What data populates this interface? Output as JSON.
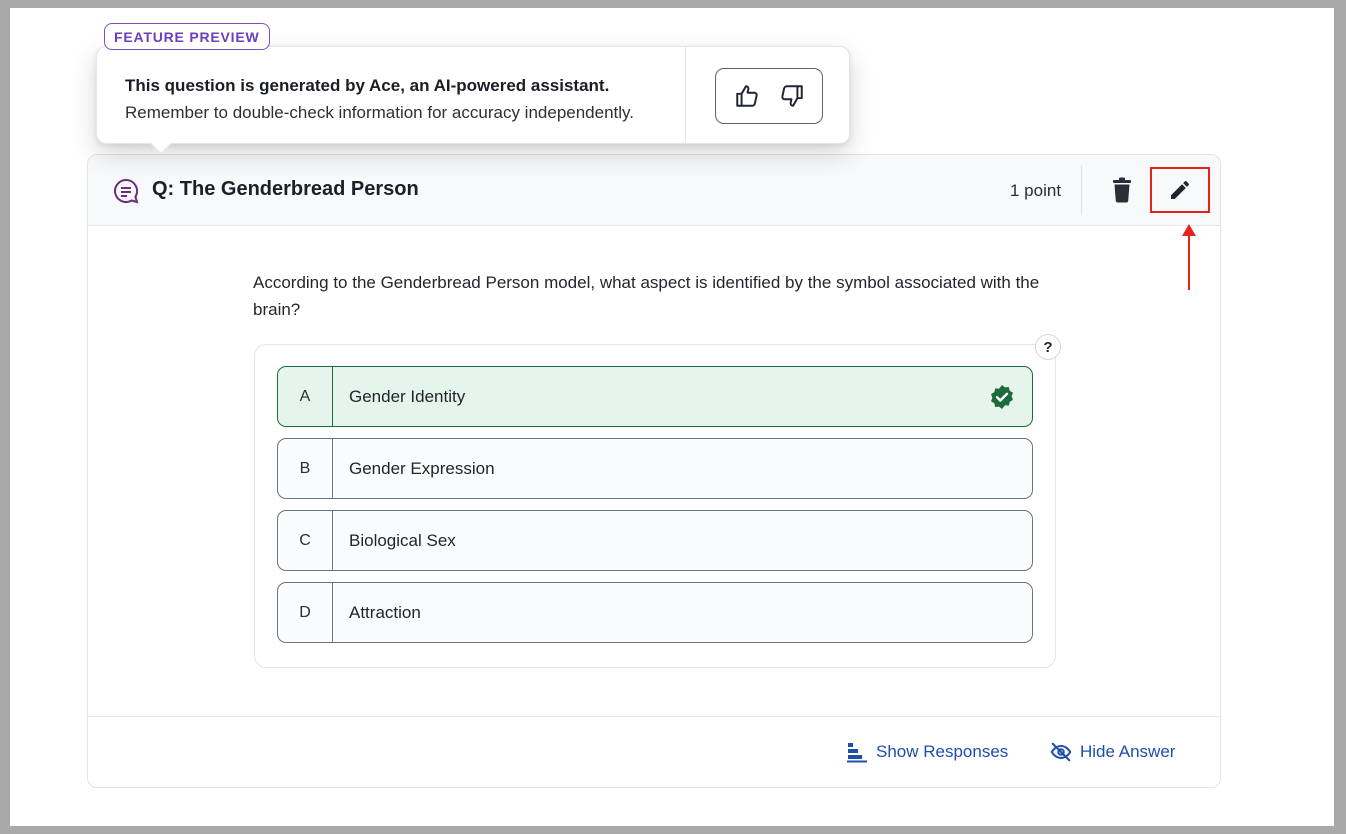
{
  "preview": {
    "badge": "FEATURE PREVIEW",
    "line1": "This question is generated by Ace, an AI-powered assistant.",
    "line2": "Remember to double-check information for accuracy independently.",
    "thumbs_up_icon": "thumbs-up-icon",
    "thumbs_down_icon": "thumbs-down-icon"
  },
  "question": {
    "title": "Q: The Genderbread Person",
    "points": "1 point",
    "text": "According to the Genderbread Person model, what aspect is identified by the symbol associated with the brain?",
    "help": "?",
    "choices": [
      {
        "letter": "A",
        "label": "Gender Identity",
        "correct": true
      },
      {
        "letter": "B",
        "label": "Gender Expression",
        "correct": false
      },
      {
        "letter": "C",
        "label": "Biological Sex",
        "correct": false
      },
      {
        "letter": "D",
        "label": "Attraction",
        "correct": false
      }
    ]
  },
  "footer": {
    "show_responses": "Show Responses",
    "hide_answer": "Hide Answer"
  },
  "colors": {
    "accent_purple": "#6b3fbe",
    "correct_green": "#1d6b3a",
    "correct_bg": "#e6f5ec",
    "link_blue": "#1e4fa8",
    "highlight_red": "#e1251b"
  }
}
